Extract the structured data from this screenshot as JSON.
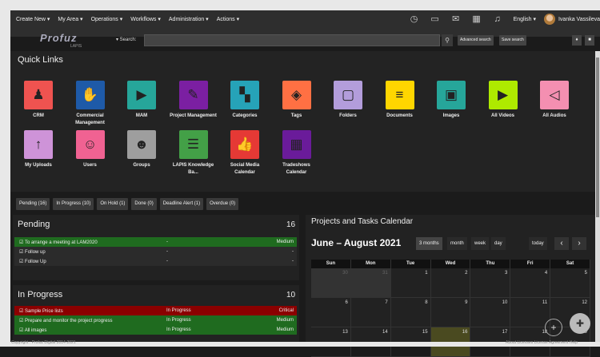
{
  "top_menu": [
    "Create New ▾",
    "My Area ▾",
    "Operations ▾",
    "Workflows ▾",
    "Administration ▾",
    "Actions ▾"
  ],
  "language": "English ▾",
  "user": "Ivanka Vassileva",
  "logo": {
    "brand": "Profuz",
    "sub": "LAPIS"
  },
  "search": {
    "label": "▾ Search:",
    "placeholder": "",
    "advanced": "Advanced search",
    "save": "Save search"
  },
  "quick_links": {
    "title": "Quick Links",
    "tiles": [
      {
        "label": "CRM",
        "color": "#ef5350"
      },
      {
        "label": "Commercial Management",
        "color": "#1e5aa8"
      },
      {
        "label": "MAM",
        "color": "#26a69a"
      },
      {
        "label": "Project Management",
        "color": "#7b1fa2"
      },
      {
        "label": "Categories",
        "color": "#26a3b8"
      },
      {
        "label": "Tags",
        "color": "#ff7043"
      },
      {
        "label": "Folders",
        "color": "#b39ddb"
      },
      {
        "label": "Documents",
        "color": "#ffd600"
      },
      {
        "label": "Images",
        "color": "#26a69a"
      },
      {
        "label": "All Videos",
        "color": "#aeea00"
      },
      {
        "label": "All Audios",
        "color": "#f48fb1"
      },
      {
        "label": "My Uploads",
        "color": "#ce93d8"
      },
      {
        "label": "Users",
        "color": "#f06292"
      },
      {
        "label": "Groups",
        "color": "#9e9e9e"
      },
      {
        "label": "LAPIS Knowledge Ba...",
        "color": "#43a047"
      },
      {
        "label": "Social Media Calendar",
        "color": "#e53935"
      },
      {
        "label": "Tradeshows Calendar",
        "color": "#6a1b9a"
      }
    ]
  },
  "tabs": [
    "Pending (16)",
    "In Progress (10)",
    "On Hold (1)",
    "Done (0)",
    "Deadline Alert (1)",
    "Overdue (0)"
  ],
  "pending": {
    "title": "Pending",
    "count": "16",
    "rows": [
      {
        "name": "To arrange a meeting at LAM2020",
        "status": "-",
        "priority": "Medium"
      },
      {
        "name": "Follow up",
        "status": "-",
        "priority": "-"
      },
      {
        "name": "Follow Up",
        "status": "-",
        "priority": "-"
      }
    ]
  },
  "in_progress": {
    "title": "In Progress",
    "count": "10",
    "rows": [
      {
        "name": "Sample Price lists",
        "status": "In Progress",
        "priority": "Critical"
      },
      {
        "name": "Prepare and monitor the project progress",
        "status": "In Progress",
        "priority": "Medium"
      },
      {
        "name": "All images",
        "status": "In Progress",
        "priority": "Medium"
      }
    ]
  },
  "calendar": {
    "title": "Projects and Tasks Calendar",
    "range": "June – August 2021",
    "views": [
      "3 months",
      "month",
      "week",
      "day"
    ],
    "today": "today",
    "prev": "‹",
    "next": "›",
    "days": [
      "Sun",
      "Mon",
      "Tue",
      "Wed",
      "Thu",
      "Fri",
      "Sat"
    ],
    "weeks": [
      [
        "30",
        "31",
        "1",
        "2",
        "3",
        "4",
        "5"
      ],
      [
        "6",
        "7",
        "8",
        "9",
        "10",
        "11",
        "12"
      ],
      [
        "13",
        "14",
        "15",
        "16",
        "17",
        "18",
        "19"
      ]
    ]
  },
  "footer": {
    "copyright": "Copyright : Profuz Digital 2014-2021",
    "links": "About   Licenses   License Agreement   Help"
  }
}
